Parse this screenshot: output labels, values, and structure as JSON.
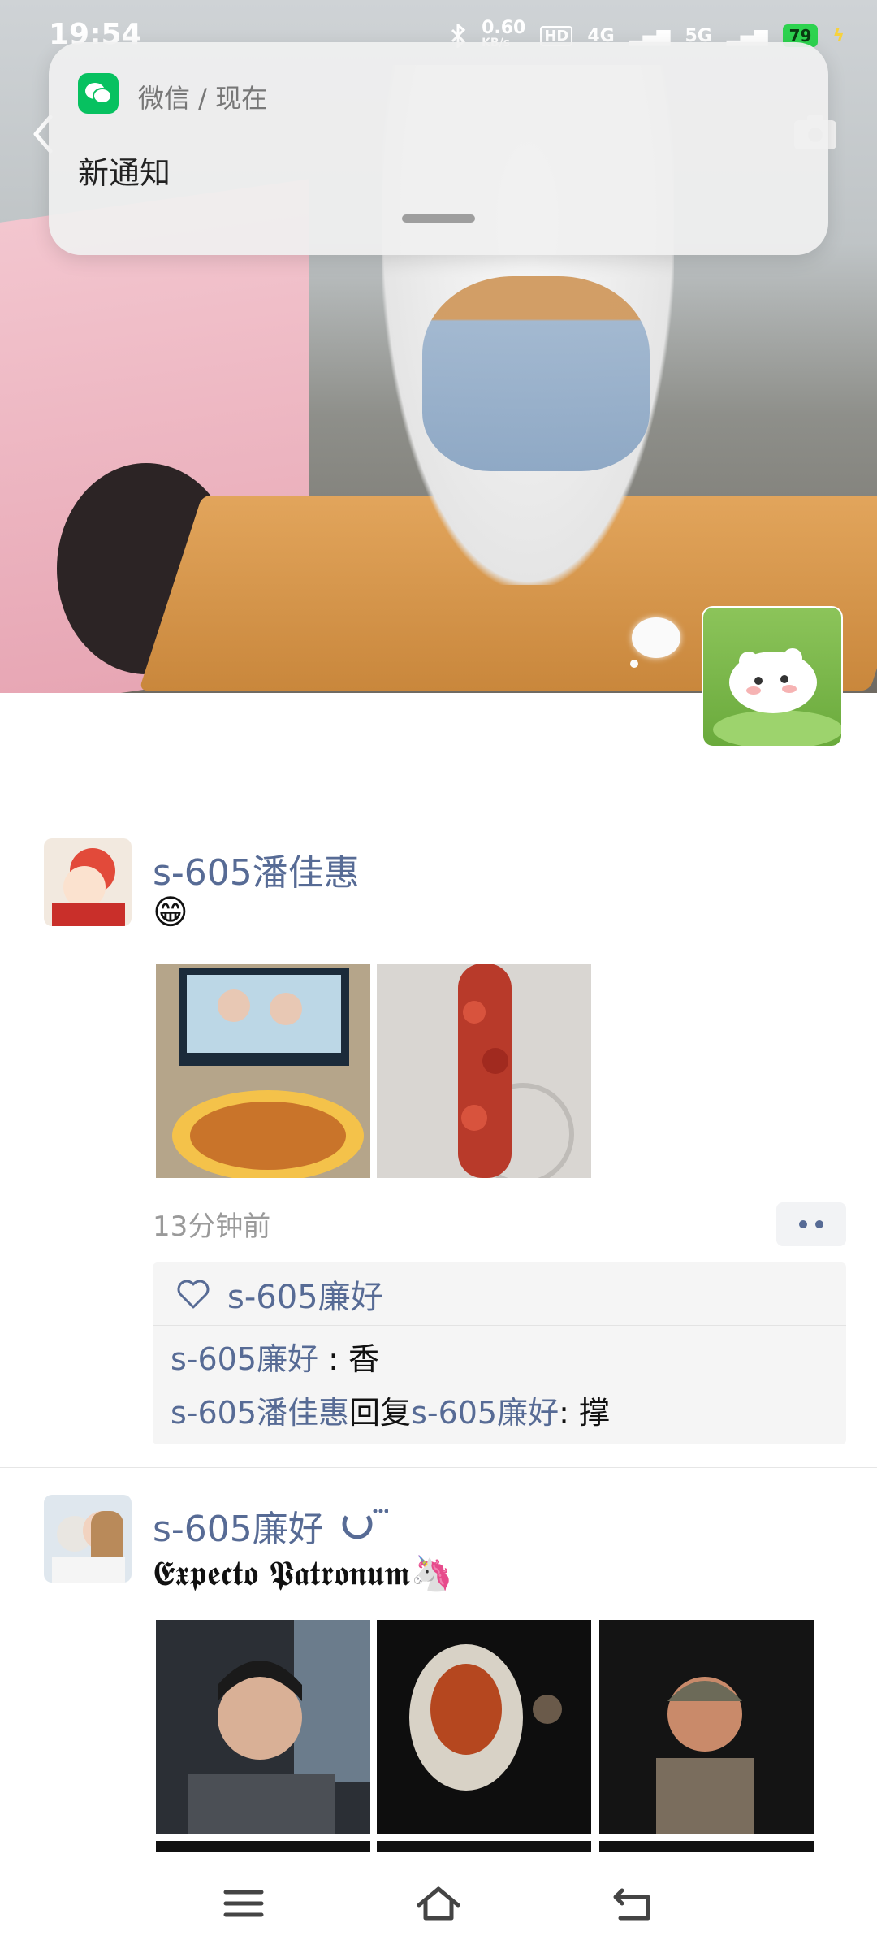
{
  "status_bar": {
    "time": "19:54",
    "net_speed": "0.60",
    "net_unit": "KB/s",
    "hd": "HD",
    "sig1": "4G",
    "sig2": "5G",
    "battery": "79"
  },
  "notification": {
    "app": "微信 / 现在",
    "message": "新通知",
    "accent": "#07c160"
  },
  "posts": [
    {
      "nick": "s-605潘佳惠",
      "text": "😁",
      "time": "13分钟前",
      "likes": "s-605廉好",
      "comments": [
        {
          "from": "s-605廉好",
          "sep": " : ",
          "to": "",
          "reply": "",
          "content": "香"
        },
        {
          "from": "s-605潘佳惠",
          "sep": ": ",
          "reply": "回复",
          "to": "s-605廉好",
          "content": "撑"
        }
      ]
    },
    {
      "nick": "s-605廉好",
      "text": "𝕰𝖝𝖕𝖊𝖈𝖙𝖔 𝕻𝖆𝖙𝖗𝖔𝖓𝖚𝖒🦄"
    }
  ],
  "colors": {
    "link": "#576b95",
    "muted": "#9a9a9a"
  }
}
